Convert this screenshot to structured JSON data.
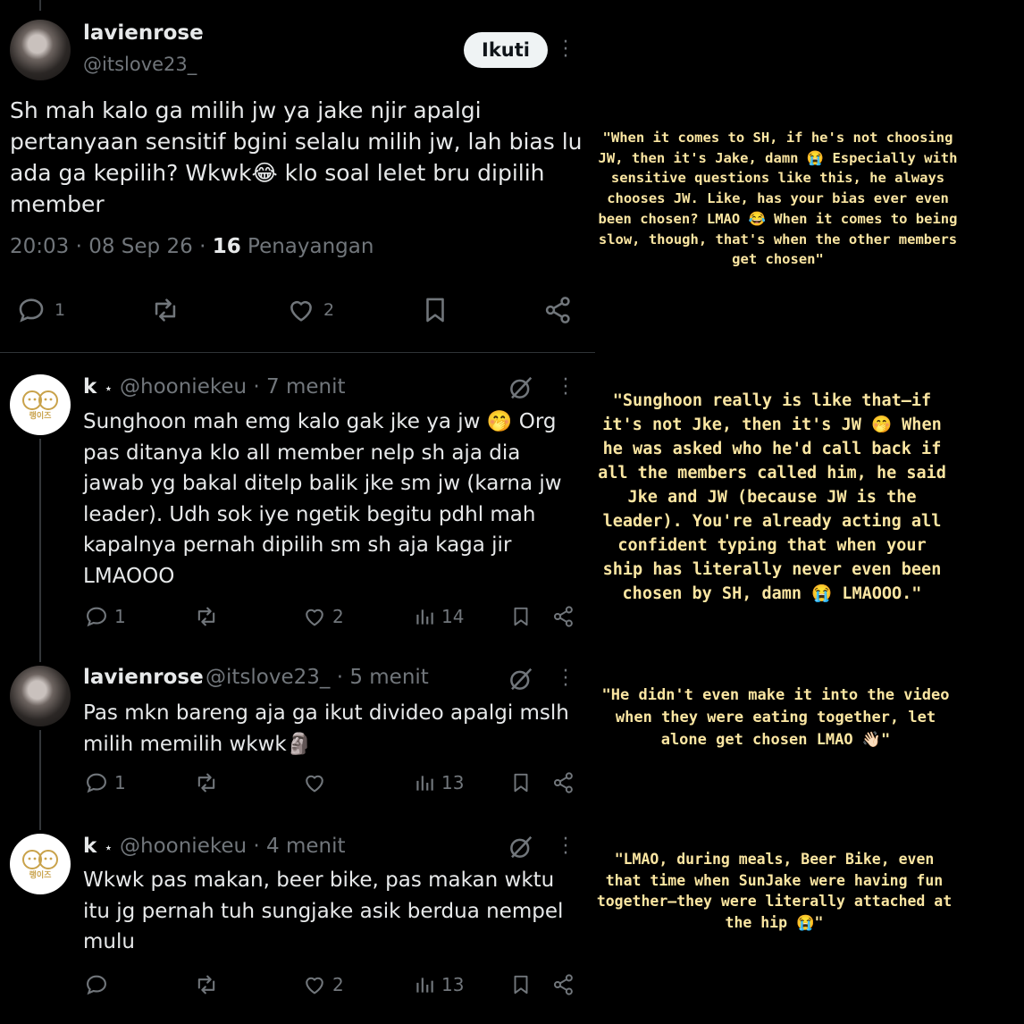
{
  "main_post": {
    "display_name": "lavienrose",
    "handle": "@itslove23_",
    "follow_label": "Ikuti",
    "text": "Sh mah kalo ga milih jw ya jake njir apalgi pertanyaan sensitif bgini selalu milih jw, lah bias lu ada ga kepilih? Wkwk😂 klo soal lelet bru dipilih member",
    "time": "20:03",
    "date": "08 Sep 26",
    "views_count": "16",
    "views_label": "Penayangan",
    "replies": "1",
    "likes": "2"
  },
  "replies": [
    {
      "display_name": "k",
      "badge": "⋆",
      "handle": "@hooniekeu",
      "time": "7 menit",
      "text": "Sunghoon mah emg kalo gak jke ya jw 🤭 Org pas ditanya klo all member nelp sh aja dia jawab yg bakal ditelp balik jke sm jw (karna jw leader). Udh sok iye ngetik begitu pdhl mah kapalnya pernah dipilih sm sh aja kaga jir LMAOOO",
      "replies": "1",
      "likes": "2",
      "views": "14"
    },
    {
      "display_name": "lavienrose",
      "handle": "@itslove23_",
      "time": "5 menit",
      "text": "Pas mkn bareng aja ga ikut divideo apalgi mslh milih memilih wkwk🗿",
      "replies": "1",
      "likes": "",
      "views": "13"
    },
    {
      "display_name": "k",
      "badge": "⋆",
      "handle": "@hooniekeu",
      "time": "4 menit",
      "text": "Wkwk pas makan, beer bike, pas makan wktu itu jg pernah tuh sungjake asik berdua nempel mulu",
      "replies": "",
      "likes": "2",
      "views": "13"
    }
  ],
  "logo_text": "랭이즈",
  "translations": [
    "\"When it comes to SH, if he's not choosing JW, then it's Jake, damn 😭 Especially with sensitive questions like this, he always chooses JW. Like, has your bias ever even been chosen? LMAO 😂 When it comes to being slow, though, that's when the other members get chosen\"",
    "\"Sunghoon really is like that—if it's not Jke, then it's JW 🤭 When he was asked who he'd call back if all the members called him, he said Jke and JW (because JW is the leader). You're already acting all confident typing that when your ship has literally never even been chosen by SH, damn 😭 LMAOOO.\"",
    "\"He didn't even make it into the video when they were eating together, let alone get chosen LMAO 👋🏻\"",
    "\"LMAO, during meals, Beer Bike, even that time when SunJake were having fun together—they were literally attached at the hip 😭\""
  ],
  "colors": {
    "background": "#000000",
    "text": "#e7e9ea",
    "muted": "#71767b",
    "translation": "#fbe6a2"
  }
}
